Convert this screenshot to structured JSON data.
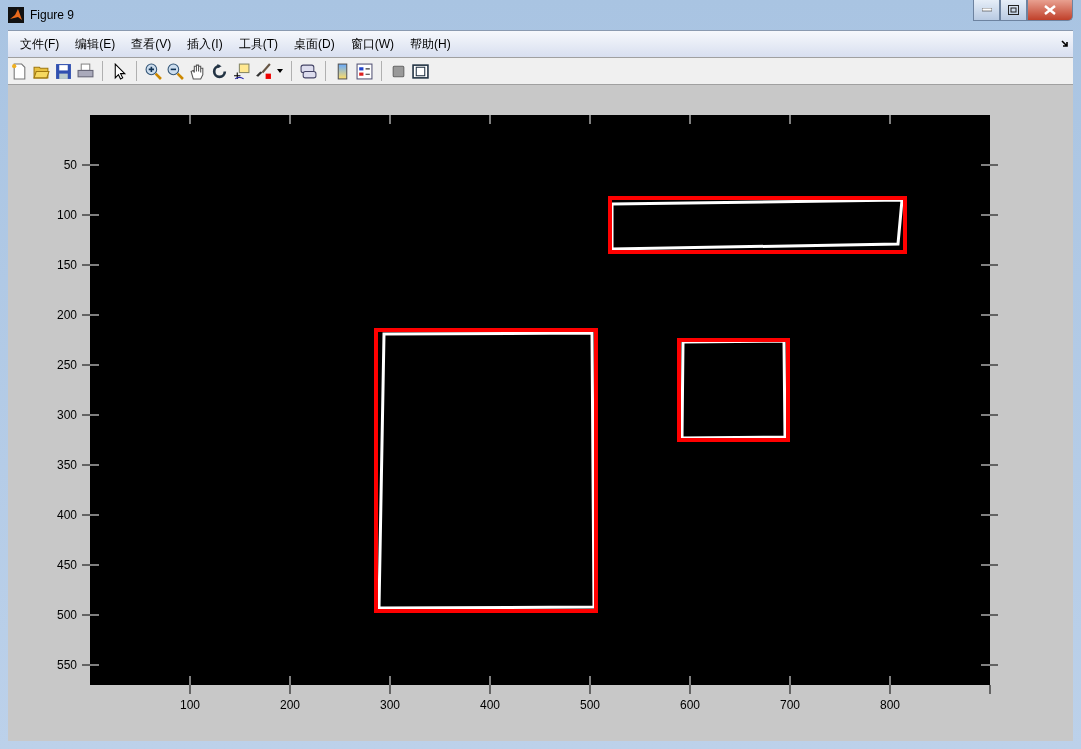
{
  "window": {
    "title": "Figure 9"
  },
  "menu": [
    {
      "label": "文件(F)"
    },
    {
      "label": "编辑(E)"
    },
    {
      "label": "查看(V)"
    },
    {
      "label": "插入(I)"
    },
    {
      "label": "工具(T)"
    },
    {
      "label": "桌面(D)"
    },
    {
      "label": "窗口(W)"
    },
    {
      "label": "帮助(H)"
    }
  ],
  "axes": {
    "xticks": [
      "100",
      "200",
      "300",
      "400",
      "500",
      "600",
      "700",
      "800"
    ],
    "yticks": [
      "50",
      "100",
      "150",
      "200",
      "250",
      "300",
      "350",
      "400",
      "450",
      "500",
      "550"
    ]
  }
}
